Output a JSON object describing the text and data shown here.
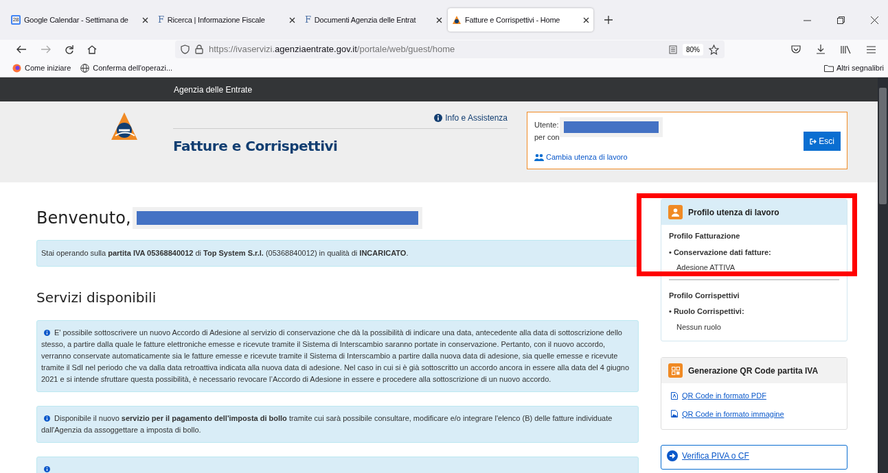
{
  "browser": {
    "tabs": [
      {
        "title": "Google Calendar - Settimana de",
        "kind": "calendar",
        "selected": false
      },
      {
        "title": "Ricerca | Informazione Fiscale",
        "kind": "letter",
        "glyph": "F",
        "selected": false
      },
      {
        "title": "Documenti Agenzia delle Entrat",
        "kind": "letter",
        "glyph": "F",
        "selected": false
      },
      {
        "title": "Fatture e Corrispettivi - Home",
        "kind": "agency",
        "selected": true
      }
    ],
    "calendar_day": "28",
    "url_prefix": "https://ivaservizi.",
    "url_host": "agenziaentrate.gov.it",
    "url_path": "/portale/web/guest/home",
    "zoom": "80%",
    "bookmarks": [
      {
        "label": "Come iniziare",
        "kind": "firefox"
      },
      {
        "label": "Conferma dell'operazi...",
        "kind": "globe"
      }
    ],
    "other_bookmarks": "Altri segnalibri"
  },
  "site": {
    "top_bar": "Agenzia delle Entrate",
    "info_link": "Info e Assistenza",
    "app_title": "Fatture e Corrispettivi",
    "user_box": {
      "user_label": "Utente:",
      "for_label": "per con",
      "change_link": "Cambia utenza di lavoro",
      "logout": "Esci"
    }
  },
  "welcome": "Benvenuto,",
  "notice": "Stai operando sulla **partita IVA 05368840012** di **Top System S.r.l.** (05368840012) in qualità di **INCARICATO**.",
  "section_title": "Servizi disponibili",
  "alerts": [
    {
      "kind": "text",
      "text": "E' possibile sottoscrivere un nuovo Accordo di Adesione al servizio di conservazione che dà la possibilità di indicare una data, antecedente alla data di sottoscrizione dello stesso, a partire dalla quale le fatture elettroniche emesse e ricevute tramite il Sistema di Interscambio saranno portate in conservazione. Pertanto, con il nuovo accordo, verranno conservate automaticamente sia le fatture emesse e ricevute tramite il Sistema di Interscambio a partire dalla nuova data di adesione, sia quelle emesse e ricevute tramite il SdI nel periodo che va dalla data retroattiva indicata alla nuova data di adesione. Nel caso in cui si è già sottoscritto un accordo ancora in essere alla data del 4 giugno 2021 e si intende sfruttare questa possibilità, è necessario revocare l’Accordo di Adesione in essere e procedere alla sottoscrizione di un nuovo accordo."
    },
    {
      "kind": "text",
      "text": "Disponibile il nuovo **servizio per il pagamento dell'imposta di bollo** tramite cui sarà possibile consultare, modificare e/o integrare l'elenco (B) delle fatture individuate dall'Agenzia da assoggettare a imposta di bollo."
    },
    {
      "kind": "cut"
    }
  ],
  "profile_card": {
    "title": "Profilo utenza di lavoro",
    "sections": [
      {
        "heading": "Profilo Fatturazione",
        "role": "• Conservazione dati fatture:",
        "value": "Adesione ATTIVA",
        "highlighted": true
      },
      {
        "heading": "Profilo Corrispettivi",
        "role": "• Ruolo Corrispettivi:",
        "value": "Nessun ruolo",
        "highlighted": false
      }
    ]
  },
  "qr_card": {
    "title": "Generazione QR Code partita IVA",
    "links": [
      {
        "label": "QR Code in formato PDF",
        "kind": "pdf"
      },
      {
        "label": "QR Code in formato immagine",
        "kind": "image"
      }
    ]
  },
  "verify_link": "Verifica PIVA o CF"
}
